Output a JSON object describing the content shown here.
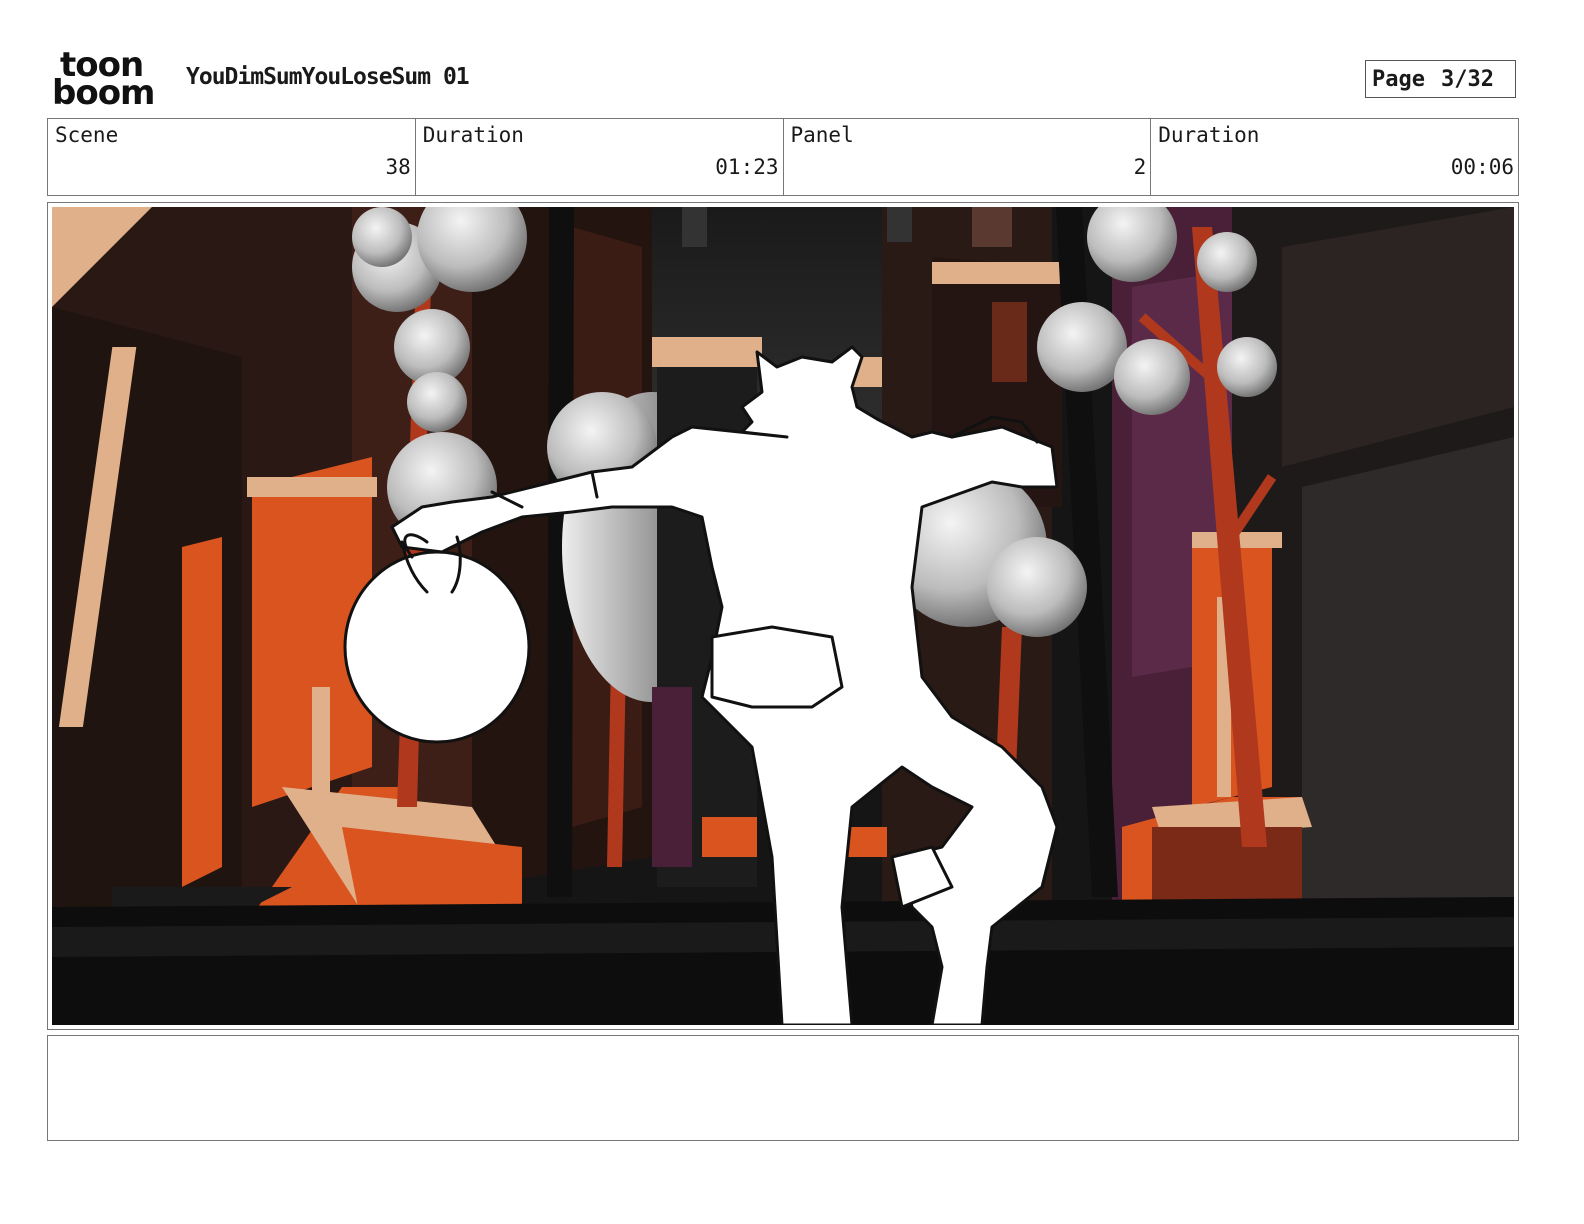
{
  "header": {
    "logo_line1": "toon",
    "logo_line2": "boom",
    "project_title": "YouDimSumYouLoseSum 01",
    "page_label": "Page",
    "page_value": "3/32"
  },
  "info": {
    "scene_label": "Scene",
    "scene_value": "38",
    "scene_duration_label": "Duration",
    "scene_duration_value": "01:23",
    "panel_label": "Panel",
    "panel_value": "2",
    "panel_duration_label": "Duration",
    "panel_duration_value": "00:06"
  },
  "colors": {
    "orange": "#d9541f",
    "dark_brick": "#5a2418",
    "purple": "#4a2039",
    "tan": "#e0b08a",
    "trunk": "#b0391d",
    "ground": "#0d0d0d",
    "sky": "#2a2a2a"
  },
  "notes": ""
}
